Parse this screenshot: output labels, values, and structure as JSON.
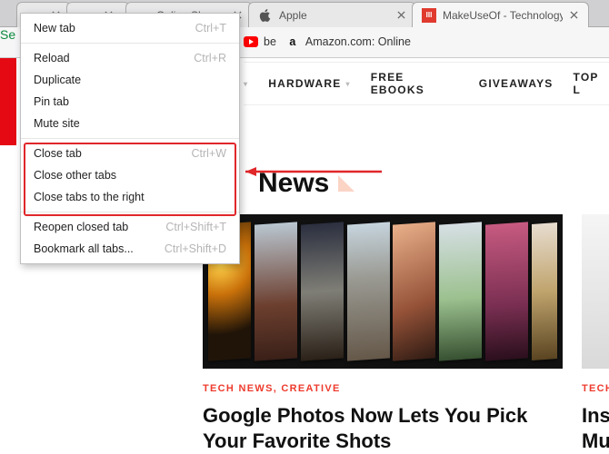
{
  "tabs": [
    {
      "title": "",
      "favicon": ""
    },
    {
      "title": "",
      "favicon": "a"
    },
    {
      "title": "Onlin...Sh...",
      "favicon": ""
    },
    {
      "title": "Apple",
      "favicon": "apple"
    },
    {
      "title": "MakeUseOf - Technology",
      "favicon": "muo",
      "active": true
    }
  ],
  "toolbar": {
    "s_text": "Se"
  },
  "bookmarks": [
    {
      "icon": "youtube",
      "label": "be"
    },
    {
      "icon": "amazon",
      "label": "Amazon.com: Online"
    }
  ],
  "nav_items": [
    {
      "label": "HARDWARE",
      "dropdown": true
    },
    {
      "label": "FREE EBOOKS",
      "dropdown": false
    },
    {
      "label": "GIVEAWAYS",
      "dropdown": false
    },
    {
      "label": "TOP L",
      "dropdown": false
    }
  ],
  "context_menu": {
    "groups": [
      [
        {
          "label": "New tab",
          "shortcut": "Ctrl+T"
        }
      ],
      [
        {
          "label": "Reload",
          "shortcut": "Ctrl+R"
        },
        {
          "label": "Duplicate",
          "shortcut": ""
        },
        {
          "label": "Pin tab",
          "shortcut": ""
        },
        {
          "label": "Mute site",
          "shortcut": ""
        }
      ],
      [
        {
          "label": "Close tab",
          "shortcut": "Ctrl+W"
        },
        {
          "label": "Close other tabs",
          "shortcut": ""
        },
        {
          "label": "Close tabs to the right",
          "shortcut": ""
        }
      ],
      [
        {
          "label": "Reopen closed tab",
          "shortcut": "Ctrl+Shift+T"
        },
        {
          "label": "Bookmark all tabs...",
          "shortcut": "Ctrl+Shift+D"
        }
      ]
    ]
  },
  "page": {
    "heading": "News",
    "article": {
      "categories": "TECH NEWS,  CREATIVE",
      "title": "Google Photos Now Lets You Pick Your Favorite Shots"
    },
    "article2": {
      "categories": "TECH",
      "title_partial_1": "Ins",
      "title_partial_2": "Mu"
    }
  },
  "nav_dropdown_glyph": "▾"
}
